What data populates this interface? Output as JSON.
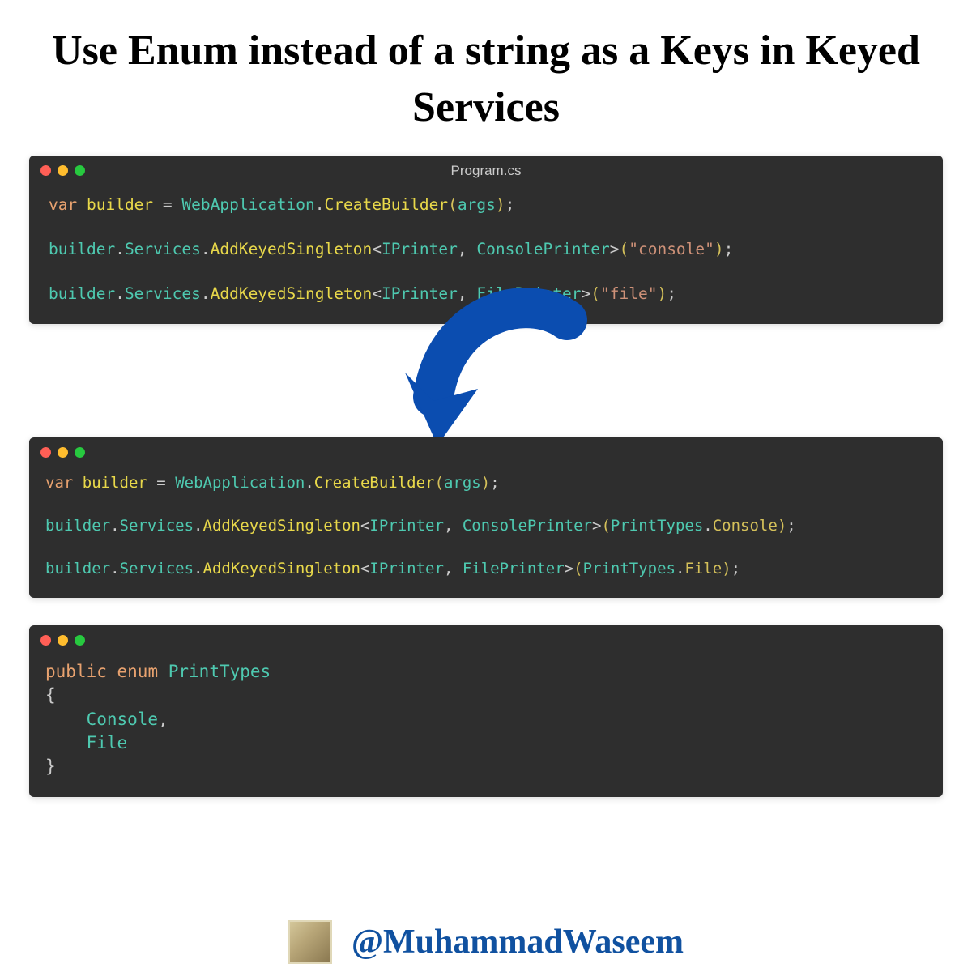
{
  "title": "Use Enum instead of a string as a Keys in Keyed Services",
  "window1": {
    "filename": "Program.cs",
    "code": {
      "l1": {
        "var": "var",
        "builder": "builder",
        "eq": " = ",
        "WebApplication": "WebApplication",
        "dot1": ".",
        "CreateBuilder": "CreateBuilder",
        "lp": "(",
        "args": "args",
        "rp": ")",
        "sc": ";"
      },
      "l2": {
        "builder": "builder",
        "dot1": ".",
        "Services": "Services",
        "dot2": ".",
        "AddKeyedSingleton": "AddKeyedSingleton",
        "lt": "<",
        "IPrinter": "IPrinter",
        "comma": ", ",
        "ConsolePrinter": "ConsolePrinter",
        "gt": ">",
        "lp": "(",
        "str": "\"console\"",
        "rp": ")",
        "sc": ";"
      },
      "l3": {
        "builder": "builder",
        "dot1": ".",
        "Services": "Services",
        "dot2": ".",
        "AddKeyedSingleton": "AddKeyedSingleton",
        "lt": "<",
        "IPrinter": "IPrinter",
        "comma": ", ",
        "FilePrinter": "FilePrinter",
        "gt": ">",
        "lp": "(",
        "str": "\"file\"",
        "rp": ")",
        "sc": ";"
      }
    }
  },
  "window2": {
    "code": {
      "l1": {
        "var": "var",
        "builder": "builder",
        "eq": " = ",
        "WebApplication": "WebApplication",
        "dot1": ".",
        "CreateBuilder": "CreateBuilder",
        "lp": "(",
        "args": "args",
        "rp": ")",
        "sc": ";"
      },
      "l2": {
        "builder": "builder",
        "dot1": ".",
        "Services": "Services",
        "dot2": ".",
        "AddKeyedSingleton": "AddKeyedSingleton",
        "lt": "<",
        "IPrinter": "IPrinter",
        "comma": ", ",
        "ConsolePrinter": "ConsolePrinter",
        "gt": ">",
        "lp": "(",
        "PrintTypes": "PrintTypes",
        "dot3": ".",
        "Console": "Console",
        "rp": ")",
        "sc": ";"
      },
      "l3": {
        "builder": "builder",
        "dot1": ".",
        "Services": "Services",
        "dot2": ".",
        "AddKeyedSingleton": "AddKeyedSingleton",
        "lt": "<",
        "IPrinter": "IPrinter",
        "comma": ", ",
        "FilePrinter": "FilePrinter",
        "gt": ">",
        "lp": "(",
        "PrintTypes": "PrintTypes",
        "dot3": ".",
        "File": "File",
        "rp": ")",
        "sc": ";"
      }
    }
  },
  "window3": {
    "code": {
      "public": "public",
      "enum": "enum",
      "PrintTypes": "PrintTypes",
      "lb": "{",
      "Console": "Console",
      "comma": ",",
      "File": "File",
      "rb": "}"
    }
  },
  "footer": {
    "handle": "@MuhammadWaseem"
  },
  "colors": {
    "arrow": "#0b4db0",
    "windowBg": "#2e2e2e"
  }
}
